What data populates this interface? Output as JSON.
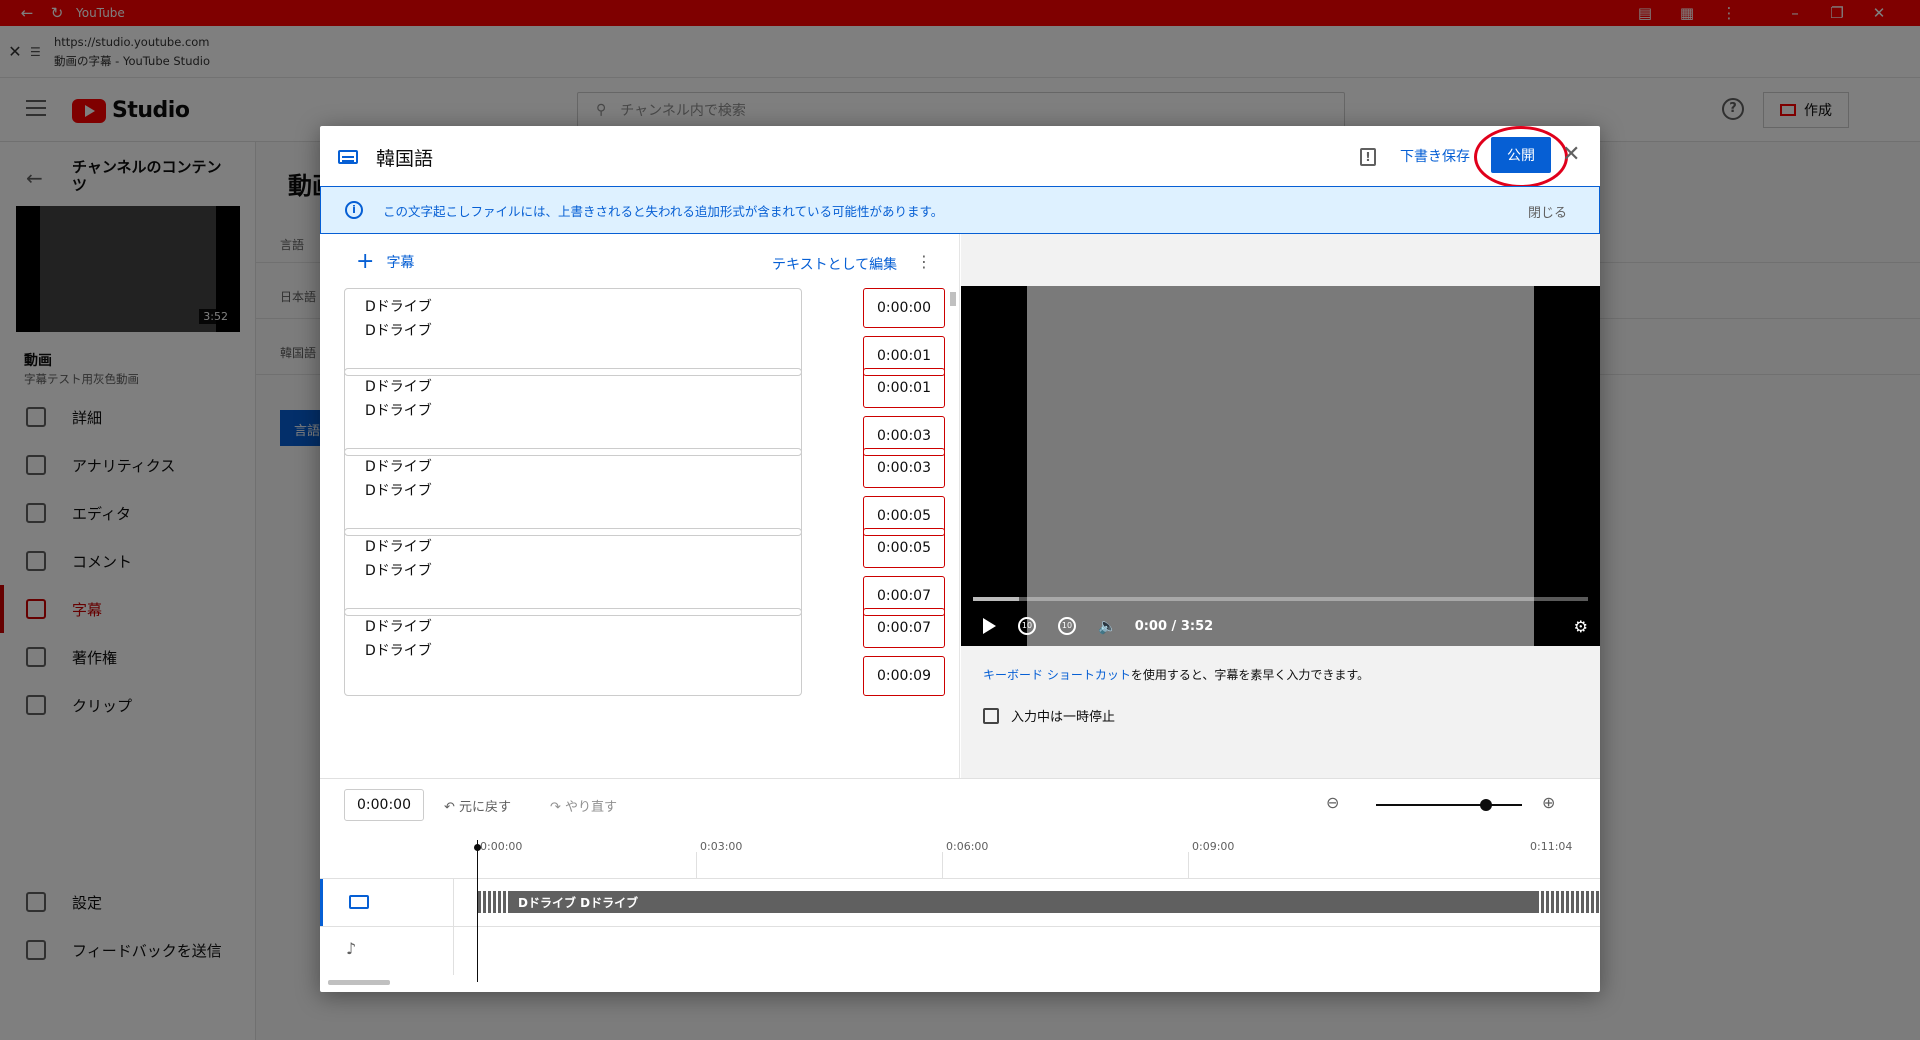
{
  "browser": {
    "tab_title": "YouTube",
    "url": "https://studio.youtube.com",
    "page_title": "動画の字幕 - YouTube Studio"
  },
  "studio": {
    "logo_text": "Studio",
    "search_placeholder": "チャンネル内で検索",
    "create_label": "作成",
    "sidebar": {
      "back_title": "チャンネルのコンテンツ",
      "video_duration": "3:52",
      "video_title": "動画",
      "video_subtitle": "字幕テスト用灰色動画",
      "items": [
        {
          "label": "詳細",
          "icon": "pencil-icon"
        },
        {
          "label": "アナリティクス",
          "icon": "analytics-icon"
        },
        {
          "label": "エディタ",
          "icon": "editor-icon"
        },
        {
          "label": "コメント",
          "icon": "comment-icon"
        },
        {
          "label": "字幕",
          "icon": "subtitles-icon",
          "active": true
        },
        {
          "label": "著作権",
          "icon": "copyright-icon"
        },
        {
          "label": "クリップ",
          "icon": "scissors-icon"
        }
      ],
      "bottom_items": [
        {
          "label": "設定",
          "icon": "gear-icon"
        },
        {
          "label": "フィードバックを送信",
          "icon": "feedback-icon"
        }
      ]
    },
    "content": {
      "title": "動画",
      "col_language": "言語",
      "row_japanese": "日本語",
      "row_korean": "韓国語",
      "button_label": "言語"
    }
  },
  "dialog": {
    "title": "韓国語",
    "save_draft": "下書き保存",
    "publish": "公開",
    "banner_text": "この文字起こしファイルには、上書きされると失われる追加形式が含まれている可能性があります。",
    "banner_close": "閉じる",
    "add_caption": "字幕",
    "edit_as_text": "テキストとして編集",
    "captions": [
      {
        "text": "Dドライブ\nDドライブ",
        "start": "0:00:00",
        "end": "0:00:01"
      },
      {
        "text": "Dドライブ\nDドライブ",
        "start": "0:00:01",
        "end": "0:00:03"
      },
      {
        "text": "Dドライブ\nDドライブ",
        "start": "0:00:03",
        "end": "0:00:05"
      },
      {
        "text": "Dドライブ\nDドライブ",
        "start": "0:00:05",
        "end": "0:00:07"
      },
      {
        "text": "Dドライブ\nDドライブ",
        "start": "0:00:07",
        "end": "0:00:09"
      }
    ],
    "player": {
      "time": "0:00 / 3:52",
      "shortcut_link": "キーボード ショートカット",
      "shortcut_rest": "を使用すると、字幕を素早く入力できます。",
      "pause_label": "入力中は一時停止",
      "progress": 0.075
    },
    "timeline": {
      "current_time": "0:00:00",
      "undo": "元に戻す",
      "redo": "やり直す",
      "ticks": [
        "0:00:00",
        "0:03:00",
        "0:06:00",
        "0:09:00",
        "0:11:04"
      ],
      "track_text": "Dドライブ Dドライブ",
      "zoom_level": 0.75
    }
  }
}
